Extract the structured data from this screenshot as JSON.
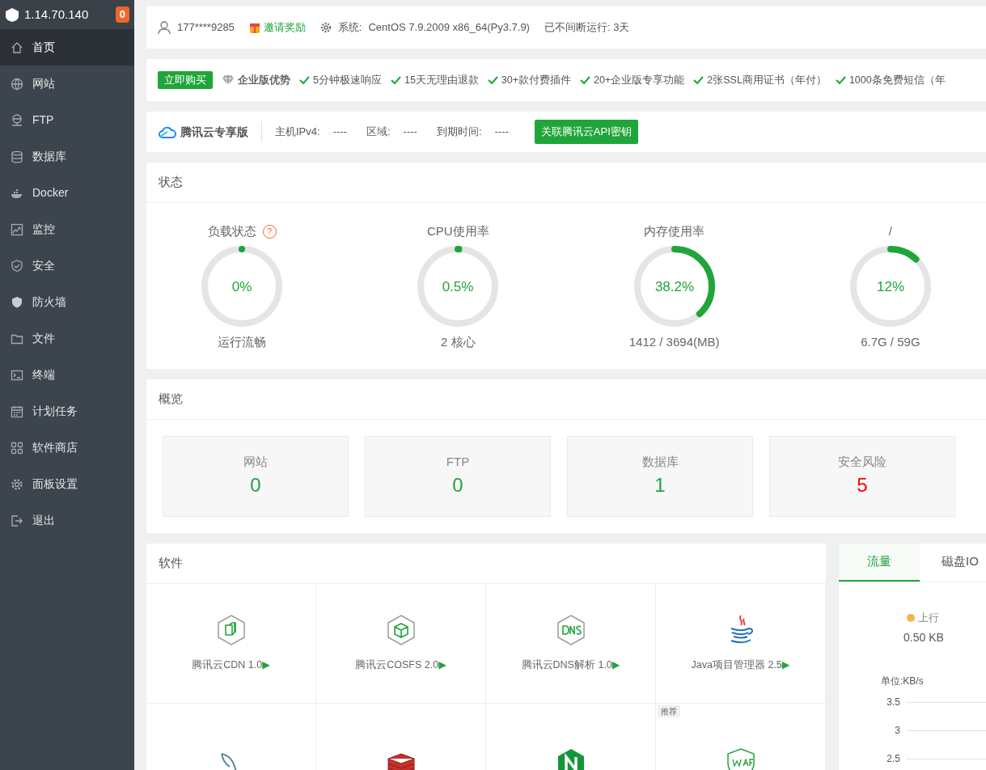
{
  "sidebar": {
    "host": "1.14.70.140",
    "badge": "0",
    "items": [
      {
        "label": "首页",
        "selected": true
      },
      {
        "label": "网站",
        "selected": false
      },
      {
        "label": "FTP",
        "selected": false
      },
      {
        "label": "数据库",
        "selected": false
      },
      {
        "label": "Docker",
        "selected": false
      },
      {
        "label": "监控",
        "selected": false
      },
      {
        "label": "安全",
        "selected": false
      },
      {
        "label": "防火墙",
        "selected": false
      },
      {
        "label": "文件",
        "selected": false
      },
      {
        "label": "终端",
        "selected": false
      },
      {
        "label": "计划任务",
        "selected": false
      },
      {
        "label": "软件商店",
        "selected": false
      },
      {
        "label": "面板设置",
        "selected": false
      },
      {
        "label": "退出",
        "selected": false
      }
    ]
  },
  "header": {
    "user": "177****9285",
    "invite": "邀请奖励",
    "system_label": "系统:",
    "system": "CentOS 7.9.2009 x86_64(Py3.7.9)",
    "uptime": "已不间断运行: 3天"
  },
  "promo": {
    "buy_button": "立即购买",
    "title": "企业版优势",
    "features": [
      "5分钟极速响应",
      "15天无理由退款",
      "30+款付费插件",
      "20+企业版专享功能",
      "2张SSL商用证书（年付）",
      "1000条免费短信（年"
    ]
  },
  "tencent": {
    "title": "腾讯云专享版",
    "fields": [
      {
        "label": "主机IPv4:",
        "value": "----"
      },
      {
        "label": "区域:",
        "value": "----"
      },
      {
        "label": "到期时间:",
        "value": "----"
      }
    ],
    "button": "关联腾讯云API密钥"
  },
  "status": {
    "title": "状态",
    "gauges": [
      {
        "label": "负载状态",
        "help": "?",
        "value": "0%",
        "level": 0,
        "caption": "运行流畅"
      },
      {
        "label": "CPU使用率",
        "value": "0.5%",
        "level": 0.005,
        "caption": "2 核心"
      },
      {
        "label": "内存使用率",
        "value": "38.2%",
        "level": 0.382,
        "caption": "1412 / 3694(MB)"
      },
      {
        "label": "/",
        "value": "12%",
        "level": 0.12,
        "caption": "6.7G / 59G"
      }
    ]
  },
  "overview": {
    "title": "概览",
    "cards": [
      {
        "label": "网站",
        "value": "0",
        "color": "#20a53a"
      },
      {
        "label": "FTP",
        "value": "0",
        "color": "#20a53a"
      },
      {
        "label": "数据库",
        "value": "1",
        "color": "#20a53a"
      },
      {
        "label": "安全风险",
        "value": "5",
        "color": "#ff0000"
      }
    ]
  },
  "software": {
    "title": "软件",
    "items": [
      {
        "kind": "cdn",
        "label": "腾讯云CDN 1.0",
        "arrow": "▶"
      },
      {
        "kind": "cosfs",
        "label": "腾讯云COSFS 2.0",
        "arrow": "▶"
      },
      {
        "kind": "dns",
        "label": "腾讯云DNS解析 1.0",
        "arrow": "▶"
      },
      {
        "kind": "java",
        "label": "Java项目管理器 2.5",
        "arrow": "▶"
      },
      {
        "kind": "mysql"
      },
      {
        "kind": "redis"
      },
      {
        "kind": "nginx"
      },
      {
        "kind": "waf",
        "tag": "推荐"
      }
    ]
  },
  "traffic": {
    "tabs": [
      {
        "label": "流量",
        "selected": true
      },
      {
        "label": "磁盘IO",
        "selected": false
      }
    ],
    "up_label": "上行",
    "up_value": "0.50 KB",
    "unit": "单位:KB/s",
    "y_ticks": [
      "3.5",
      "3",
      "2.5"
    ]
  }
}
